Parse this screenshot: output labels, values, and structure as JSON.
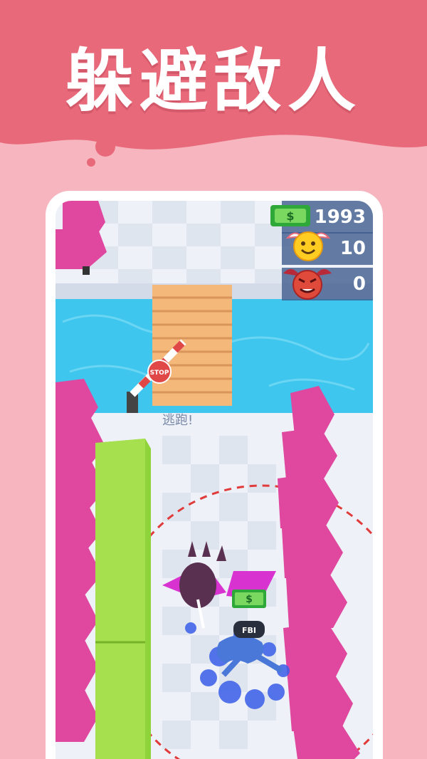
{
  "banner": {
    "title": "躲避敌人",
    "color": "#e86a7a"
  },
  "hud": {
    "cash": {
      "value": "1993",
      "icon": "cash-icon"
    },
    "angels": {
      "value": "10",
      "icon": "smiley-angel-icon"
    },
    "devils": {
      "value": "0",
      "icon": "devil-face-icon"
    }
  },
  "game": {
    "hint": "逃跑!",
    "stop_sign": "STOP",
    "enemy_badge": "FBI",
    "colors": {
      "water": "#3fc6ee",
      "tree": "#e0479e",
      "hedge": "#8fd33a",
      "bridge": "#f3b87a"
    }
  }
}
